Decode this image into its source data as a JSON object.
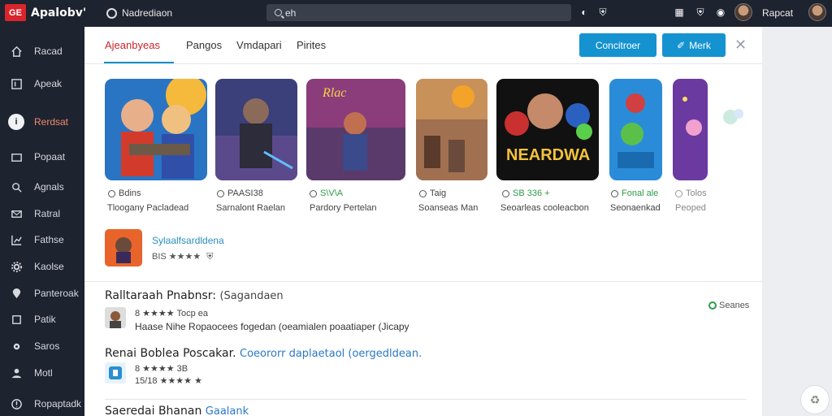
{
  "app": {
    "logo_text": "GE",
    "title": "Apalobv'"
  },
  "topbar": {
    "status_text": "Nadrediaon",
    "search_value": "eh",
    "user_name": "Rapcat",
    "icons": [
      "status-circle-icon",
      "search-icon",
      "moon-icon",
      "shield-icon",
      "grid-icon",
      "shield-icon",
      "bell-icon",
      "avatar",
      "avatar"
    ]
  },
  "sidebar": {
    "items": [
      {
        "label": "Racad",
        "icon": "home-icon"
      },
      {
        "label": "Apeak",
        "icon": "window-icon"
      },
      {
        "label": "Rerdsat",
        "icon": "info-icon",
        "active": true
      },
      {
        "label": "Popaat",
        "icon": "folder-icon"
      },
      {
        "label": "Agnals",
        "icon": "search-icon"
      },
      {
        "label": "Ratral",
        "icon": "mail-icon"
      },
      {
        "label": "Fathse",
        "icon": "chart-icon"
      },
      {
        "label": "Kaolse",
        "icon": "gear-icon"
      },
      {
        "label": "Panteroak",
        "icon": "location-icon"
      },
      {
        "label": "Patik",
        "icon": "square-icon"
      },
      {
        "label": "Saros",
        "icon": "settings-icon"
      },
      {
        "label": "Motl",
        "icon": "user-icon"
      },
      {
        "label": "Ropaptadk",
        "icon": "help-icon"
      }
    ]
  },
  "tabs": [
    {
      "label": "Ajeanbyeas",
      "active": true
    },
    {
      "label": "Pangos"
    },
    {
      "label": "Vmdapari"
    },
    {
      "label": "Pirites"
    }
  ],
  "buttons": {
    "primary_label": "Concitroer",
    "secondary_label": "Merk"
  },
  "games": [
    {
      "rating": "Bdins",
      "subtitle": "Tloogany Pacladead",
      "rating_green": false
    },
    {
      "rating": "PAASI38",
      "subtitle": "Sarnalont Raelan",
      "rating_green": false
    },
    {
      "rating": "S\\V\\A",
      "subtitle": "Pardory Pertelan",
      "rating_green": true
    },
    {
      "rating": "Taig",
      "subtitle": "Soanseas Man",
      "rating_green": false
    },
    {
      "rating": "SB 336 +",
      "subtitle": "Seoarleas cooleacbon",
      "rating_green": true
    },
    {
      "rating": "Fonal ale",
      "subtitle": "Seonaenkad",
      "rating_green": true
    },
    {
      "rating": "Tolos",
      "subtitle": "Peoped",
      "rating_green": false
    }
  ],
  "game_banner_text": "NEARDWA",
  "game_banner_small": "Rlac",
  "featured": {
    "name": "Sylaalfsardldena",
    "meta": "BIS ★★★★"
  },
  "section1": {
    "title": "Ralltaraah Pnabnsr:",
    "subtitle": "(Sagandaen",
    "right_link": "Seanes",
    "review_meta": "8 ★★★★ Tocp ea",
    "review_text": "Haase Nihe Ropaocees fogedan (oeamialen poaatiaper (Jicapy"
  },
  "section2": {
    "title": "Renai Boblea Poscakar.",
    "link_text": "Coeororr daplaetaol (oergedldean.",
    "meta1": "8 ★★★★ 3B",
    "meta2": "15/18 ★★★★ ★"
  },
  "section3": {
    "title": "Saeredai Bhanan",
    "link_text": "Gaalank"
  },
  "colors": {
    "topbar_bg": "#1e2330",
    "accent_blue": "#1593d1",
    "active_tab": "#c8252c",
    "star": "#f2b531",
    "green": "#2d9b49"
  }
}
